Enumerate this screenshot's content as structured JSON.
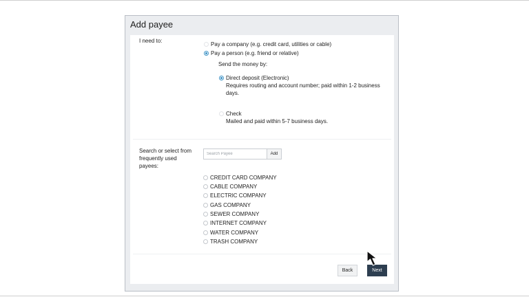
{
  "dialog": {
    "title": "Add payee"
  },
  "need": {
    "label": "I need to:",
    "options": [
      {
        "label": "Pay a company (e.g. credit card, utilities or cable)",
        "checked": false
      },
      {
        "label": "Pay a person (e.g. friend or relative)",
        "checked": true
      }
    ]
  },
  "send": {
    "label": "Send the money by:",
    "options": [
      {
        "label": "Direct deposit (Electronic)",
        "desc_line1": "Requires routing and account number; paid within 1-2 business",
        "desc_line2": "days.",
        "checked": true
      },
      {
        "label": "Check",
        "desc_line1": "Mailed and paid within 5-7 business days.",
        "checked": false
      }
    ]
  },
  "search": {
    "label_line1": "Search or select from",
    "label_line2": "frequently used",
    "label_line3": "payees:",
    "placeholder": "Search Payee",
    "add_label": "Add"
  },
  "payees": [
    "CREDIT CARD COMPANY",
    "CABLE COMPANY",
    "ELECTRIC COMPANY",
    "GAS COMPANY",
    "SEWER COMPANY",
    "INTERNET COMPANY",
    "WATER COMPANY",
    "TRASH COMPANY"
  ],
  "footer": {
    "back_label": "Back",
    "next_label": "Next"
  },
  "colors": {
    "accent": "#3f93c6",
    "primary_button": "#2d3e50",
    "dialog_bg": "#ebedf0"
  },
  "icons": {
    "cursor": "mouse-pointer-icon"
  }
}
